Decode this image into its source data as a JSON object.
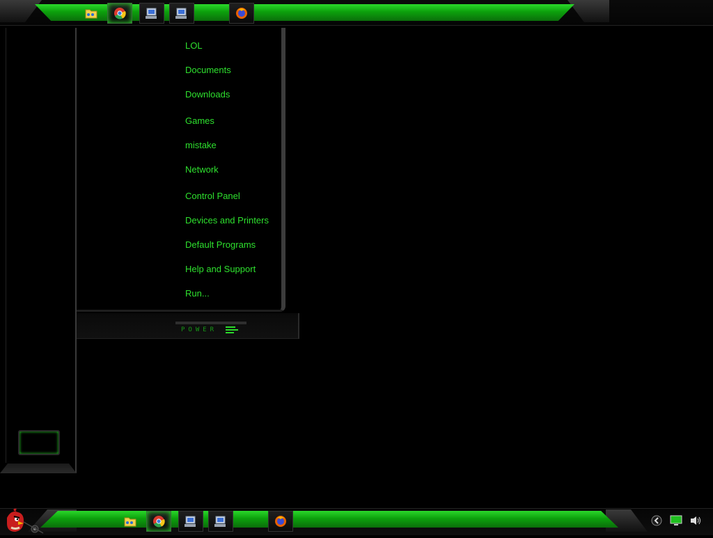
{
  "top_bar": {
    "buttons": [
      {
        "icon": "folder-icon",
        "active": false
      },
      {
        "icon": "chrome-icon",
        "active": true
      },
      {
        "icon": "computer-icon",
        "active": false
      },
      {
        "icon": "computer-icon",
        "active": false
      },
      {
        "icon": "firefox-icon",
        "active": false
      }
    ]
  },
  "start_menu": {
    "items": [
      "LOL",
      "Documents",
      "Downloads",
      "Games",
      "mistake",
      "Network",
      "Control Panel",
      "Devices and Printers",
      "Default Programs",
      "Help and Support",
      "Run..."
    ],
    "power_label": "POWER"
  },
  "taskbar": {
    "start_icon": "angry-bird-icon",
    "pinned": [
      "folder-icon",
      "chrome-icon",
      "computer-icon",
      "computer-icon",
      "firefox-icon"
    ],
    "tray": [
      "back-icon",
      "monitor-icon",
      "speaker-icon"
    ]
  },
  "colors": {
    "accent": "#2ee02e",
    "background": "#000000"
  }
}
